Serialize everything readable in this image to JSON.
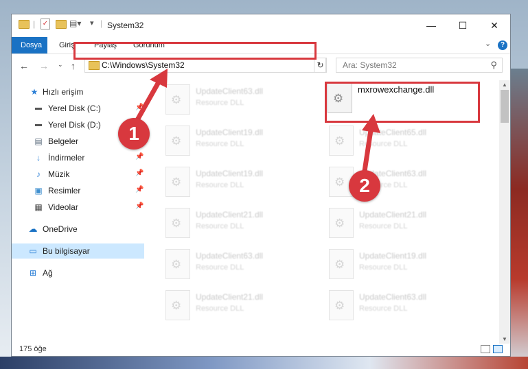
{
  "window": {
    "title": "System32"
  },
  "ribbon": {
    "tabs": [
      "Dosya",
      "Giriş",
      "Paylaş",
      "Görünüm"
    ]
  },
  "address": {
    "path": "C:\\Windows\\System32"
  },
  "search": {
    "placeholder": "Ara: System32"
  },
  "nav": {
    "items": [
      {
        "label": "Hızlı erişim",
        "icon": "star-icon",
        "pinned": false
      },
      {
        "label": "Yerel Disk (C:)",
        "icon": "drive-icon",
        "pinned": true
      },
      {
        "label": "Yerel Disk (D:)",
        "icon": "drive-icon",
        "pinned": false
      },
      {
        "label": "Belgeler",
        "icon": "document-icon",
        "pinned": true
      },
      {
        "label": "İndirmeler",
        "icon": "download-icon",
        "pinned": true
      },
      {
        "label": "Müzik",
        "icon": "music-icon",
        "pinned": true
      },
      {
        "label": "Resimler",
        "icon": "pictures-icon",
        "pinned": true
      },
      {
        "label": "Videolar",
        "icon": "videos-icon",
        "pinned": true
      },
      {
        "label": "OneDrive",
        "icon": "cloud-icon",
        "pinned": false
      },
      {
        "label": "Bu bilgisayar",
        "icon": "computer-icon",
        "pinned": false,
        "selected": true
      },
      {
        "label": "Ağ",
        "icon": "network-icon",
        "pinned": false
      }
    ]
  },
  "files": {
    "featured": {
      "name": "mxrowexchange.dll"
    },
    "left_column": [
      {
        "name": "UpdateClient63.dll",
        "type": "Resource DLL"
      },
      {
        "name": "UpdateClient19.dll",
        "type": "Resource DLL"
      },
      {
        "name": "UpdateClient19.dll",
        "type": "Resource DLL"
      },
      {
        "name": "UpdateClient21.dll",
        "type": "Resource DLL"
      },
      {
        "name": "UpdateClient63.dll",
        "type": "Resource DLL"
      },
      {
        "name": "UpdateClient21.dll",
        "type": "Resource DLL"
      }
    ],
    "right_column": [
      {
        "name": "UpdateClient65.dll",
        "type": "Resource DLL"
      },
      {
        "name": "UpdateClient63.dll",
        "type": "Resource DLL"
      },
      {
        "name": "UpdateClient21.dll",
        "type": "Resource DLL"
      },
      {
        "name": "UpdateClient19.dll",
        "type": "Resource DLL"
      },
      {
        "name": "UpdateClient63.dll",
        "type": "Resource DLL"
      }
    ]
  },
  "status": {
    "count": "175 öğe"
  },
  "annotations": {
    "step1": "1",
    "step2": "2",
    "color": "#d8383e"
  },
  "colors": {
    "accent": "#1a72c4",
    "selection": "#cce8ff"
  }
}
